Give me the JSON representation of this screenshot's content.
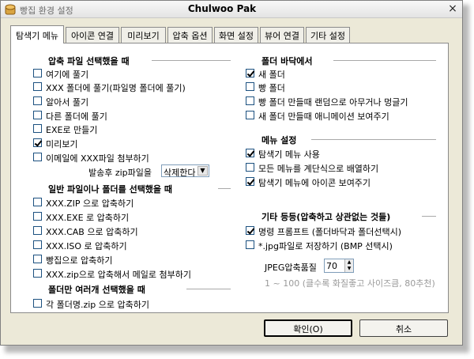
{
  "window": {
    "title_left": "빵집 환경 설정",
    "title_center": "Chulwoo Pak",
    "close_glyph": "×"
  },
  "tabs": [
    {
      "label": "탐색기 메뉴",
      "active": true
    },
    {
      "label": "아이콘 연결",
      "active": false
    },
    {
      "label": "미리보기",
      "active": false
    },
    {
      "label": "압축 옵션",
      "active": false
    },
    {
      "label": "화면 설정",
      "active": false
    },
    {
      "label": "뷰어 연결",
      "active": false
    },
    {
      "label": "기타 설정",
      "active": false
    }
  ],
  "left": {
    "group1": {
      "title": "압축 파일 선택했을 때",
      "items": [
        {
          "label": "여기에 풀기",
          "checked": false
        },
        {
          "label": "XXX 폴더에 풀기(파일명 폴더에 풀기)",
          "checked": false
        },
        {
          "label": "알아서 풀기",
          "checked": false
        },
        {
          "label": "다른 폴더에 풀기",
          "checked": false
        },
        {
          "label": "EXE로 만들기",
          "checked": false
        },
        {
          "label": "미리보기",
          "checked": true
        },
        {
          "label": "이메일에 XXX파일 첨부하기",
          "checked": false
        }
      ],
      "sent_zip_label": "발송후 zip파일을",
      "sent_zip_value": "삭제한다"
    },
    "group2": {
      "title": "일반 파일이나 폴더를 선택했을 때",
      "items": [
        {
          "label": "XXX.ZIP 으로 압축하기",
          "checked": false
        },
        {
          "label": "XXX.EXE 로 압축하기",
          "checked": false
        },
        {
          "label": "XXX.CAB 으로 압축하기",
          "checked": false
        },
        {
          "label": "XXX.ISO 로 압축하기",
          "checked": false
        },
        {
          "label": "빵집으로 압축하기",
          "checked": false
        },
        {
          "label": "XXX.zip으로 압축해서 메일로 첨부하기",
          "checked": false
        }
      ]
    },
    "group3": {
      "title": "폴더만 여러개 선택했을 때",
      "items": [
        {
          "label": "각 폴더명.zip 으로 압축하기",
          "checked": false
        }
      ]
    }
  },
  "right": {
    "group1": {
      "title": "폴더 바닥에서",
      "items": [
        {
          "label": "새 폴더",
          "checked": true
        },
        {
          "label": "빵 폴더",
          "checked": false
        },
        {
          "label": "빵 폴더 만들때 랜덤으로 아무거나 멍글기",
          "checked": false
        },
        {
          "label": "새 폴더 만들때 애니메이션 보여주기",
          "checked": false
        }
      ]
    },
    "group2": {
      "title": "메뉴 설정",
      "items": [
        {
          "label": "탐색기 메뉴 사용",
          "checked": true
        },
        {
          "label": "모든 메뉴를 계단식으로 배열하기",
          "checked": false
        },
        {
          "label": "탐색기 메뉴에 아이콘 보여주기",
          "checked": true
        }
      ]
    },
    "group3": {
      "title": "기타 등등(압축하고 상관없는 것들)",
      "items": [
        {
          "label": "명령 프롬프트 (폴더바닥과 폴더선택시)",
          "checked": true
        },
        {
          "label": "*.jpg파일로 저장하기 (BMP 선택시)",
          "checked": false
        }
      ],
      "jpeg_label": "JPEG압축품질",
      "jpeg_value": "70",
      "jpeg_hint": "1 ~ 100 (클수록 화질좋고 사이즈큼, 80추천)"
    }
  },
  "buttons": {
    "ok": "확인(O)",
    "cancel": "취소"
  }
}
